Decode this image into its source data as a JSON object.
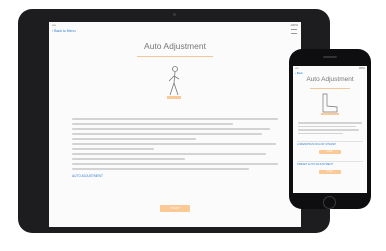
{
  "tablet": {
    "status": {
      "carrier": "•••• ",
      "time": "9:41 AM",
      "battery": "100%"
    },
    "nav": {
      "back_label": "‹ Back to Menu"
    },
    "title": "Auto Adjustment",
    "link_label": "AUTO ADJUSTMENT",
    "action_label": "START"
  },
  "phone": {
    "status": {
      "carrier": "••••",
      "time": "9:41",
      "battery": "100%"
    },
    "nav": {
      "back_label": "‹ Back"
    },
    "title": "Auto Adjustment",
    "section1_label": "LOREMIPSUM DOLOR SITAMET",
    "section2_label": "PRESET AUTO ADJUSTMENT",
    "action1_label": "START",
    "action2_label": "START"
  },
  "colors": {
    "accent": "#fbc995",
    "link": "#2f7fd3",
    "title": "#777777"
  }
}
